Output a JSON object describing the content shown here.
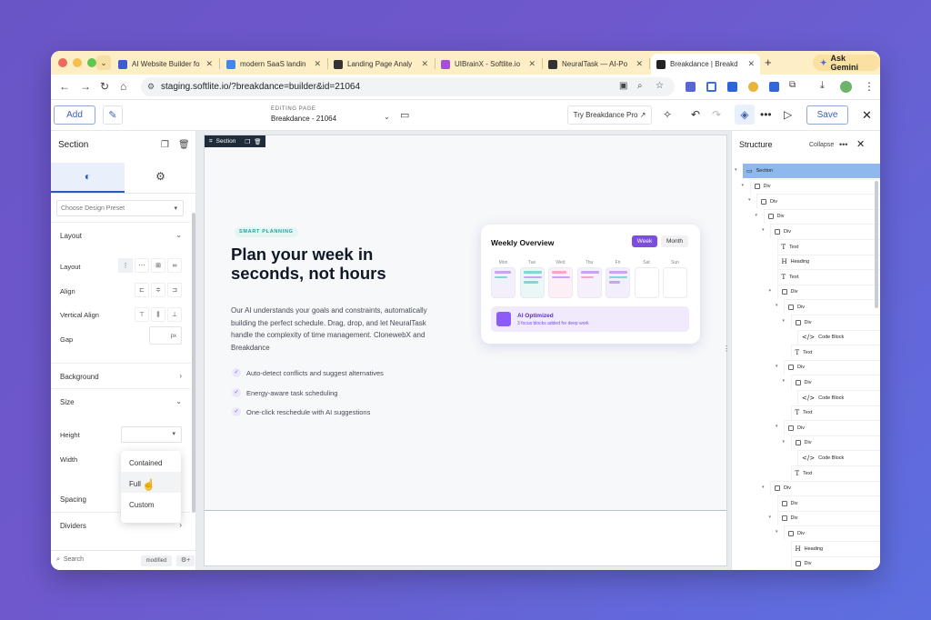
{
  "browser": {
    "tabs": [
      {
        "title": "AI Website Builder fo",
        "icon": "s-logo-icon",
        "color": "#3d5bd9"
      },
      {
        "title": "modern SaaS landin",
        "icon": "google-g-icon",
        "color": "#4285f4"
      },
      {
        "title": "Landing Page Analy",
        "icon": "spiral-icon",
        "color": "#333333"
      },
      {
        "title": "UIBrainX - Softlite.io",
        "icon": "star-sparkle-icon",
        "color": "#a64de0"
      },
      {
        "title": "NeuralTask — AI-Po",
        "icon": "neuraltask-icon",
        "color": "#333333"
      },
      {
        "title": "Breakdance | Breakd",
        "icon": "breakdance-logo-icon",
        "color": "#222222"
      }
    ],
    "new_tab": "+",
    "gemini_label": "Ask Gemini",
    "url": "staging.softlite.io/?breakdance=builder&id=21064"
  },
  "builder": {
    "add_label": "Add",
    "editing_caption": "EDITING PAGE",
    "editing_page": "Breakdance - 21064",
    "try_label": "Try Breakdance Pro",
    "save_label": "Save"
  },
  "left_panel": {
    "title": "Section",
    "preset_placeholder": "Choose Design Preset",
    "layout_section": "Layout",
    "layout_label": "Layout",
    "align_label": "Align",
    "valign_label": "Vertical Align",
    "gap_label": "Gap",
    "gap_unit": "px",
    "background_section": "Background",
    "size_section": "Size",
    "height_label": "Height",
    "width_label": "Width",
    "width_options": [
      "Contained",
      "Full",
      "Custom"
    ],
    "spacing_section": "Spacing",
    "dividers_section": "Dividers",
    "search_placeholder": "Search",
    "modified_label": "modified"
  },
  "canvas": {
    "section_label": "Section",
    "badge": "SMART PLANNING",
    "heading": "Plan your week in seconds, not hours",
    "paragraph": "Our AI understands your goals and constraints, automatically building the perfect schedule. Drag, drop, and let NeuralTask handle the complexity of time management. ClonewebX and Breakdance",
    "features": [
      "Auto-detect conflicts and suggest alternatives",
      "Energy-aware task scheduling",
      "One-click reschedule with AI suggestions"
    ],
    "card": {
      "title": "Weekly Overview",
      "week": "Week",
      "month": "Month",
      "days": [
        "Mon",
        "Tue",
        "Wed",
        "Thu",
        "Fri",
        "Sat",
        "Sun"
      ],
      "ai_title": "AI Optimized",
      "ai_sub": "3 focus blocks added for deep work"
    },
    "colors": {
      "accent": "#7c4dde",
      "teal": "#20a29a"
    }
  },
  "structure": {
    "title": "Structure",
    "collapse_label": "Collapse",
    "nodes": [
      {
        "label": "Section",
        "type": "section",
        "depth": 0
      },
      {
        "label": "Div",
        "type": "div",
        "depth": 1
      },
      {
        "label": "Div",
        "type": "div",
        "depth": 2
      },
      {
        "label": "Div",
        "type": "div",
        "depth": 3
      },
      {
        "label": "Div",
        "type": "div",
        "depth": 4
      },
      {
        "label": "Text",
        "type": "text",
        "depth": 5
      },
      {
        "label": "Heading",
        "type": "heading",
        "depth": 5
      },
      {
        "label": "Text",
        "type": "text",
        "depth": 5
      },
      {
        "label": "Div",
        "type": "div",
        "depth": 5
      },
      {
        "label": "Div",
        "type": "div",
        "depth": 6
      },
      {
        "label": "Div",
        "type": "div",
        "depth": 7
      },
      {
        "label": "Code Block",
        "type": "code",
        "depth": 8
      },
      {
        "label": "Text",
        "type": "text",
        "depth": 7
      },
      {
        "label": "Div",
        "type": "div",
        "depth": 6
      },
      {
        "label": "Div",
        "type": "div",
        "depth": 7
      },
      {
        "label": "Code Block",
        "type": "code",
        "depth": 8
      },
      {
        "label": "Text",
        "type": "text",
        "depth": 7
      },
      {
        "label": "Div",
        "type": "div",
        "depth": 6
      },
      {
        "label": "Div",
        "type": "div",
        "depth": 7
      },
      {
        "label": "Code Block",
        "type": "code",
        "depth": 8
      },
      {
        "label": "Text",
        "type": "text",
        "depth": 7
      },
      {
        "label": "Div",
        "type": "div",
        "depth": 4
      },
      {
        "label": "Div",
        "type": "div",
        "depth": 5
      },
      {
        "label": "Div",
        "type": "div",
        "depth": 5
      },
      {
        "label": "Div",
        "type": "div",
        "depth": 6
      },
      {
        "label": "Heading",
        "type": "heading",
        "depth": 7
      },
      {
        "label": "Div",
        "type": "div",
        "depth": 7
      }
    ]
  }
}
